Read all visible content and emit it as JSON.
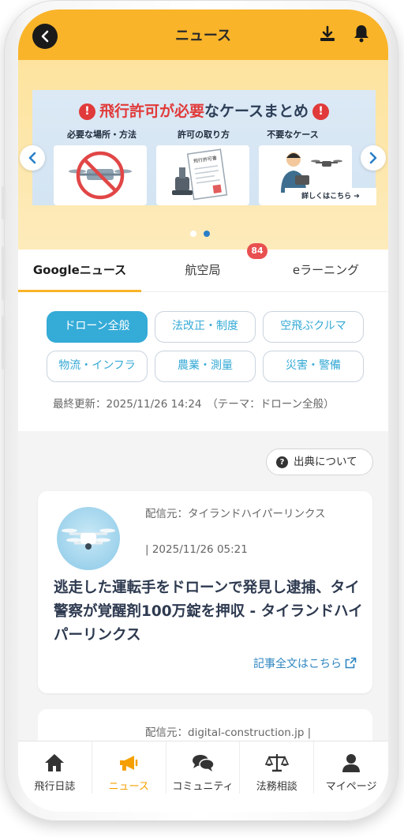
{
  "header": {
    "title": "ニュース"
  },
  "banner": {
    "title_red": "飛行許可が必要",
    "title_rest": "なケースまとめ",
    "cards": [
      "必要な場所・方法",
      "許可の取り方",
      "不要なケース"
    ],
    "permit_label": "飛行許可書",
    "more": "詳しくはこちら ➔"
  },
  "tabs": {
    "items": [
      "Googleニュース",
      "航空局",
      "eラーニング"
    ],
    "badge": "84"
  },
  "chips": [
    "ドローン全般",
    "法改正・制度",
    "空飛ぶクルマ",
    "物流・インフラ",
    "農業・測量",
    "災害・警備"
  ],
  "updated": "最終更新：2025/11/26 14:24　（テーマ：ドローン全般）",
  "source_button": "出典について",
  "articles": [
    {
      "source": "配信元：タイランドハイパーリンクス",
      "date": "| 2025/11/26 05:21",
      "headline": "逃走した運転手をドローンで発見し逮捕、タイ警察が覚醒剤100万錠を押収 - タイランドハイパーリンクス",
      "link": "記事全文はこちら"
    },
    {
      "source": "配信元：digital-construction.jp |"
    }
  ],
  "bottom_nav": [
    "飛行日誌",
    "ニュース",
    "コミュニティ",
    "法務相談",
    "マイページ"
  ],
  "colors": {
    "accent": "#f9b429",
    "chip_active": "#35abd7",
    "link": "#2e86c1",
    "badge": "#e95050"
  }
}
